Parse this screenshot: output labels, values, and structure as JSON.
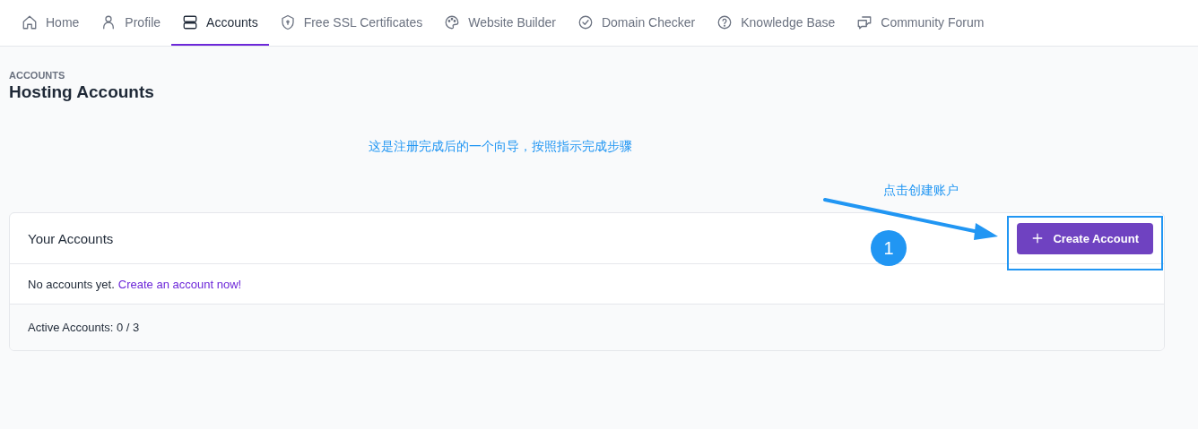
{
  "nav": [
    {
      "label": "Home",
      "selected": false
    },
    {
      "label": "Profile",
      "selected": false
    },
    {
      "label": "Accounts",
      "selected": true
    },
    {
      "label": "Free SSL Certificates",
      "selected": false
    },
    {
      "label": "Website Builder",
      "selected": false
    },
    {
      "label": "Domain Checker",
      "selected": false
    },
    {
      "label": "Knowledge Base",
      "selected": false
    },
    {
      "label": "Community Forum",
      "selected": false
    }
  ],
  "header": {
    "breadcrumb": "ACCOUNTS",
    "title": "Hosting Accounts"
  },
  "card": {
    "title": "Your Accounts",
    "button": "Create Account",
    "empty_text": "No accounts yet.",
    "empty_link": "Create an account now!",
    "footer": "Active Accounts: 0 / 3"
  },
  "annotations": {
    "note": "这是注册完成后的一个向导，按照指示完成步骤",
    "step_label": "点击创建账户",
    "step_number": "1"
  }
}
